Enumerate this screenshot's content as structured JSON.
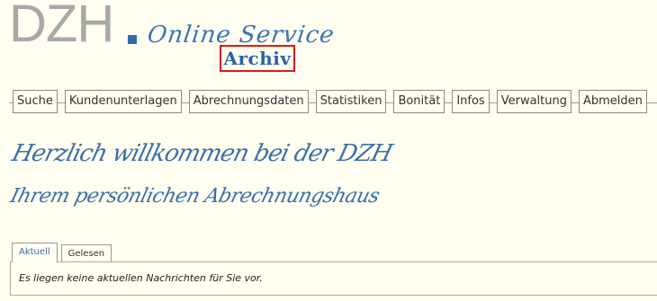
{
  "header": {
    "logo_text": "DZH",
    "service_text": "Online Service",
    "archive_label": "Archiv"
  },
  "nav": {
    "items": [
      {
        "label": "Suche"
      },
      {
        "label": "Kundenunterlagen"
      },
      {
        "label": "Abrechnungsdaten"
      },
      {
        "label": "Statistiken"
      },
      {
        "label": "Bonität"
      },
      {
        "label": "Infos"
      },
      {
        "label": "Verwaltung"
      },
      {
        "label": "Abmelden"
      }
    ]
  },
  "welcome": {
    "line1": "Herzlich willkommen bei der DZH",
    "line2": "Ihrem persönlichen Abrechnungshaus"
  },
  "tabs": [
    {
      "label": "Aktuell",
      "active": true
    },
    {
      "label": "Gelesen",
      "active": false
    }
  ],
  "message": {
    "text": "Es liegen keine aktuellen Nachrichten für Sie vor."
  },
  "colors": {
    "background": "#fffef0",
    "brand_blue": "#3a6eac",
    "archive_border": "#d91b1b",
    "logo_gray": "#a8a8a8"
  }
}
